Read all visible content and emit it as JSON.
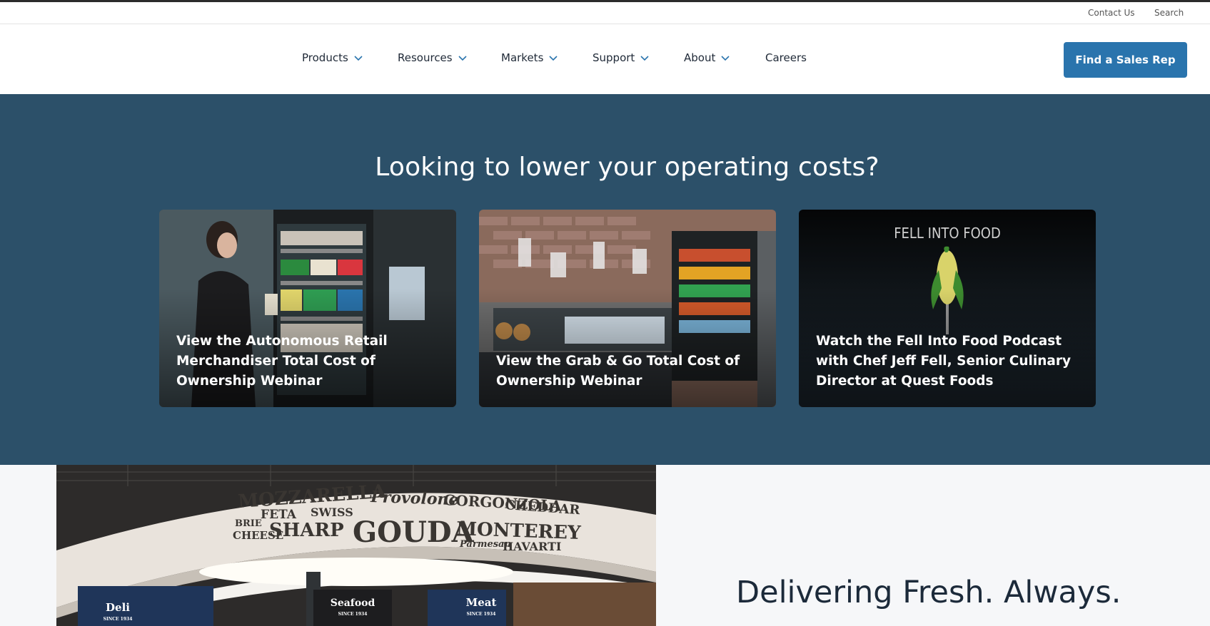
{
  "utility": {
    "contact": "Contact Us",
    "search": "Search"
  },
  "nav": {
    "items": [
      {
        "label": "Products"
      },
      {
        "label": "Resources"
      },
      {
        "label": "Markets"
      },
      {
        "label": "Support"
      },
      {
        "label": "About"
      },
      {
        "label": "Careers"
      }
    ],
    "cta": "Find a Sales Rep"
  },
  "promo": {
    "heading": "Looking to lower your operating costs?",
    "cards": [
      {
        "title": "View the Autonomous Retail Merchandiser Total Cost of Ownership Webinar"
      },
      {
        "title": "View the Grab & Go Total Cost of Ownership Webinar"
      },
      {
        "title": "Watch the Fell Into Food Podcast with Chef Jeff Fell, Senior Culinary Director at Quest Foods",
        "logo_text": "FELL INTO FOOD"
      }
    ]
  },
  "fresh": {
    "heading": "Delivering Fresh. Always.",
    "sign_words": [
      "MOZZARELLA",
      "Provolone",
      "GORGONZOLA",
      "CHEDDAR",
      "FETA",
      "SWISS",
      "BRIE",
      "CHEESE",
      "SHARP",
      "GOUDA",
      "MONTEREY",
      "Parmesan",
      "HAVARTI"
    ],
    "store_signs": [
      {
        "label": "Deli",
        "sub": "SINCE 1934"
      },
      {
        "label": "Seafood",
        "sub": "SINCE 1934"
      },
      {
        "label": "Meat",
        "sub": "SINCE 1934"
      }
    ]
  },
  "colors": {
    "brand_blue": "#2a74ad",
    "promo_bg": "#2c5069"
  }
}
